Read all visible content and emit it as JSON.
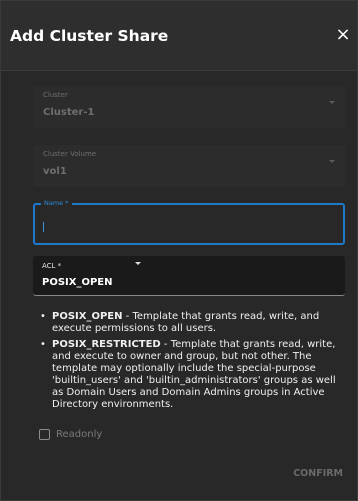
{
  "dialog": {
    "title": "Add Cluster Share",
    "close_glyph": "×",
    "close_icon": "close-icon"
  },
  "fields": {
    "cluster": {
      "label": "Cluster",
      "value": "Cluster-1",
      "disabled": true
    },
    "cluster_volume": {
      "label": "Cluster Volume",
      "value": "vol1",
      "disabled": true
    },
    "name": {
      "label": "Name *",
      "value": "",
      "focused": true
    },
    "acl": {
      "label": "ACL *",
      "value": "POSIX_OPEN"
    }
  },
  "help": {
    "items": [
      {
        "term": "POSIX_OPEN",
        "text": " - Template that grants read, write, and execute permissions to all users."
      },
      {
        "term": "POSIX_RESTRICTED",
        "text": " - Template that grants read, write, and execute to owner and group, but not other. The template may optionally include the special-purpose 'builtin_users' and 'builtin_administrators' groups as well as Domain Users and Domain Admins groups in Active Directory environments."
      }
    ],
    "bullet": "•"
  },
  "readonly": {
    "label": "Readonly",
    "checked": false
  },
  "actions": {
    "confirm_label": "CONFIRM",
    "confirm_enabled": false
  },
  "colors": {
    "accent": "#1f79ca",
    "dialog_bg": "#282828",
    "header_bg": "#2e2e2e",
    "disabled_text": "#6f6f6f"
  }
}
